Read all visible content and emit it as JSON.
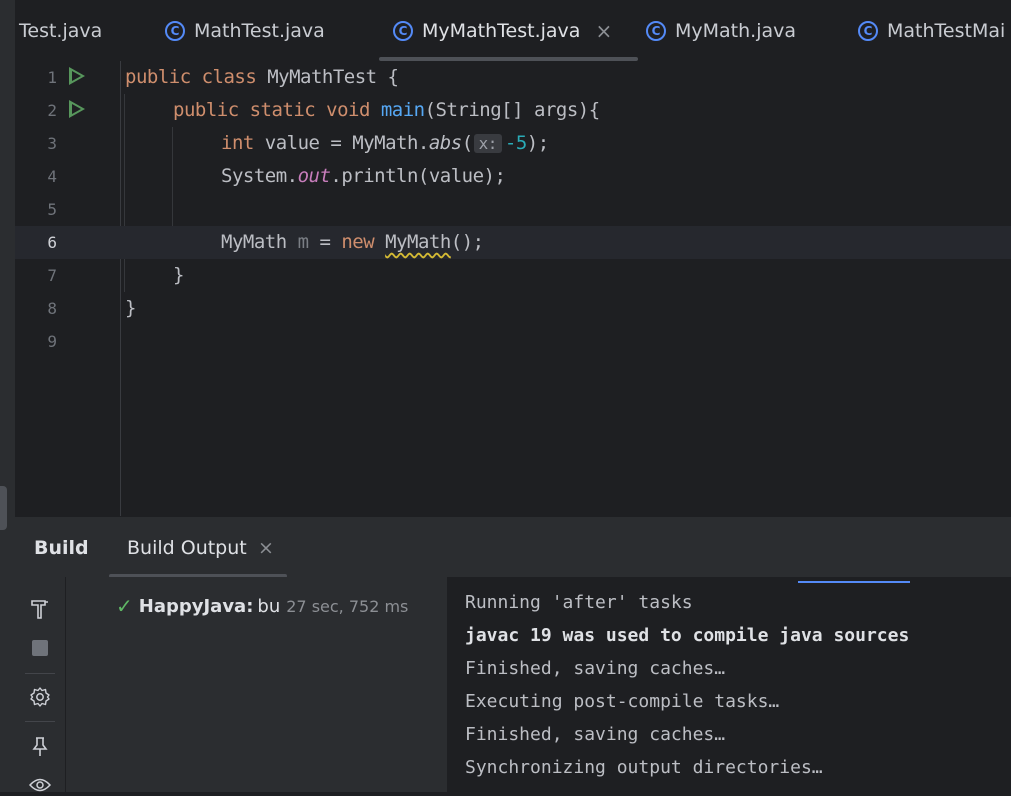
{
  "tabs": [
    {
      "label": "Test.java"
    },
    {
      "label": "MathTest.java"
    },
    {
      "label": "MyMathTest.java",
      "active": true
    },
    {
      "label": "MyMath.java"
    },
    {
      "label": "MathTestMai"
    }
  ],
  "tab_close_glyph": "×",
  "class_icon_glyph": "C",
  "editor": {
    "line_numbers": [
      "1",
      "2",
      "3",
      "4",
      "5",
      "6",
      "7",
      "8",
      "9"
    ],
    "current_line": "6",
    "param_hint": "x:",
    "code": {
      "l1_kw": "public class ",
      "l1_name": "MyMathTest {",
      "l2_kw": "public static void ",
      "l2_fn": "main",
      "l2_rest": "(String[] args){",
      "l3_kw": "int",
      "l3_a": " value = MyMath.",
      "l3_fn": "abs",
      "l3_b": "(",
      "l3_num": "-5",
      "l3_c": ");",
      "l4_a": "System.",
      "l4_field": "out",
      "l4_b": ".println(value);",
      "l6_a": "MyMath ",
      "l6_var": "m",
      "l6_b": " = ",
      "l6_kw": "new",
      "l6_c": " ",
      "l6_cls": "MyMath",
      "l6_d": "();",
      "l7": "}",
      "l8": "}"
    }
  },
  "build_panel": {
    "title": "Build",
    "tab_label": "Build Output",
    "tab_close": "×",
    "tree": {
      "name": "HappyJava:",
      "rest": "bu",
      "time": "27 sec, 752 ms"
    },
    "console_lines": [
      "Running 'after' tasks",
      "javac 19 was used to compile java sources",
      "Finished, saving caches…",
      "Executing post-compile tasks…",
      "Finished, saving caches…",
      "Synchronizing output directories…"
    ]
  },
  "colors": {
    "accent": "#548af7",
    "success": "#5fb865",
    "run": "#57965c"
  }
}
